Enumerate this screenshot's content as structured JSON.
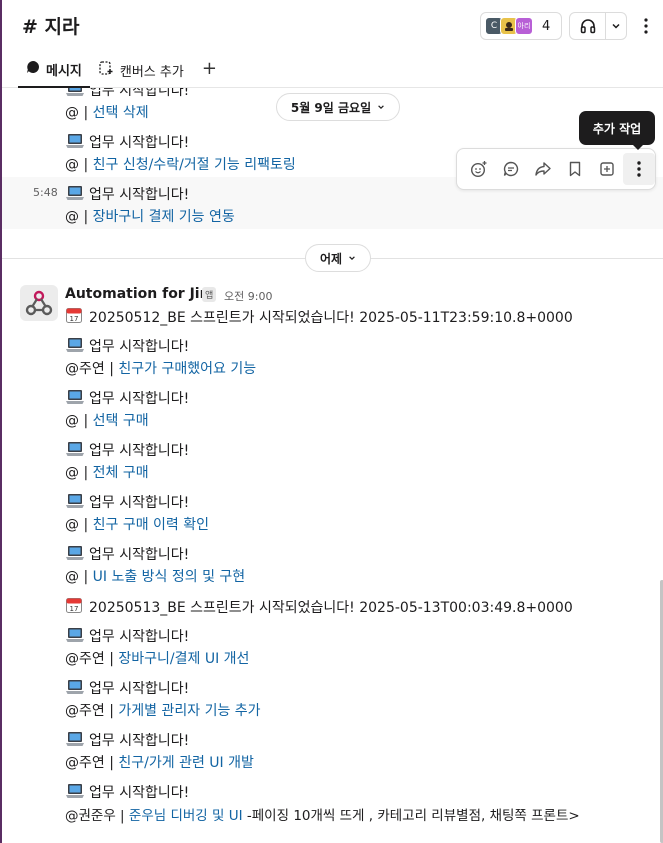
{
  "header": {
    "channel_title": "# 지라",
    "member_count": "4",
    "member_avatars": [
      {
        "initial": "C",
        "color": "#4a5a66"
      },
      {
        "initial": "",
        "color": "#e8c24a"
      },
      {
        "initial": "아리",
        "color": "#b85fd6"
      }
    ]
  },
  "tabs": [
    {
      "label": "메시지",
      "icon": "message-icon"
    },
    {
      "label": "캔버스 추가",
      "icon": "canvas-icon"
    }
  ],
  "dividers": {
    "first": "5월 9일 금요일",
    "second": "어제"
  },
  "tooltip": "추가 작업",
  "top_messages": [
    {
      "title": "업무 시작합니다!",
      "prefix": "@ |",
      "link": "선택 삭제"
    },
    {
      "title": "업무 시작합니다!",
      "prefix": "@ |",
      "link": "친구 신청/수락/거절 기능 리팩토링"
    },
    {
      "time": "5:48",
      "title": "업무 시작합니다!",
      "prefix": "@ |",
      "link": "장바구니 결제 기능 연동"
    }
  ],
  "automation": {
    "sender": "Automation for Jira",
    "badge": "앱",
    "time": "오전 9:00",
    "sprint1": "20250512_BE 스프린트가 시작되었습니다! 2025-05-11T23:59:10.8+0000",
    "sprint2": "20250513_BE 스프린트가 시작되었습니다! 2025-05-13T00:03:49.8+0000",
    "messages1": [
      {
        "title": "업무 시작합니다!",
        "prefix": "@주연 |",
        "link": "친구가 구매했어요 기능"
      },
      {
        "title": "업무 시작합니다!",
        "prefix": "@ |",
        "link": "선택 구매"
      },
      {
        "title": "업무 시작합니다!",
        "prefix": "@ |",
        "link": "전체 구매"
      },
      {
        "title": "업무 시작합니다!",
        "prefix": "@ |",
        "link": "친구 구매 이력 확인"
      },
      {
        "title": "업무 시작합니다!",
        "prefix": "@ |",
        "link": "UI 노출 방식 정의 및 구현"
      }
    ],
    "messages2": [
      {
        "title": "업무 시작합니다!",
        "prefix": "@주연 |",
        "link": "장바구니/결제 UI 개선"
      },
      {
        "title": "업무 시작합니다!",
        "prefix": "@주연 |",
        "link": "가게별 관리자 기능 추가"
      },
      {
        "title": "업무 시작합니다!",
        "prefix": "@주연 |",
        "link": "친구/가게 관련 UI 개발"
      },
      {
        "title": "업무 시작합니다!",
        "prefix": "@권준우 |",
        "link": "준우님 디버깅 및 UI",
        "suffix": "-페이징 10개씩 뜨게 , 카테고리 리뷰별점, 채팅쪽 프론트>"
      }
    ]
  }
}
